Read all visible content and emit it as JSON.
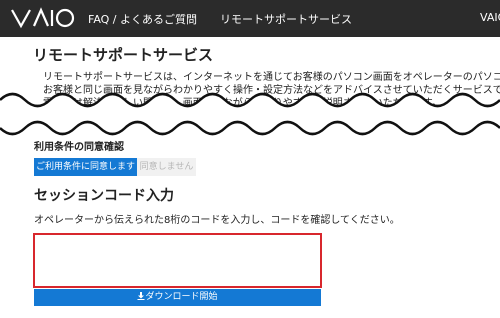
{
  "header": {
    "logo_text": "VAIO",
    "nav_faq": "FAQ / よくあるご質問",
    "nav_service": "リモートサポートサービス",
    "nav_right": "VAIO"
  },
  "intro": {
    "title": "リモートサポートサービス",
    "desc_line1": "リモートサポートサービスは、インターネットを通じてお客様のパソコン画面をオペレーターのパソコン画面に",
    "desc_line2": "お客様と同じ画面を見ながらわかりやすく操作・設定方法などをアドバイスさせていただくサービスです。",
    "desc_line3": "電話では解決が難しい問題も、画面を見ながらわかりやすくご説明させていただきます。"
  },
  "terms": {
    "label": "利用条件の同意確認",
    "agree_button": "ご利用条件に同意します",
    "disagree_button": "同意しません"
  },
  "session": {
    "heading": "セッションコード入力",
    "instruction": "オペレーターから伝えられた8桁のコードを入力し、コードを確認してください。",
    "code_value": "",
    "download_button": "ダウンロード開始"
  },
  "colors": {
    "header_bg": "#2b2b2b",
    "accent_blue": "#1479d4",
    "highlight_red": "#d8272d"
  }
}
